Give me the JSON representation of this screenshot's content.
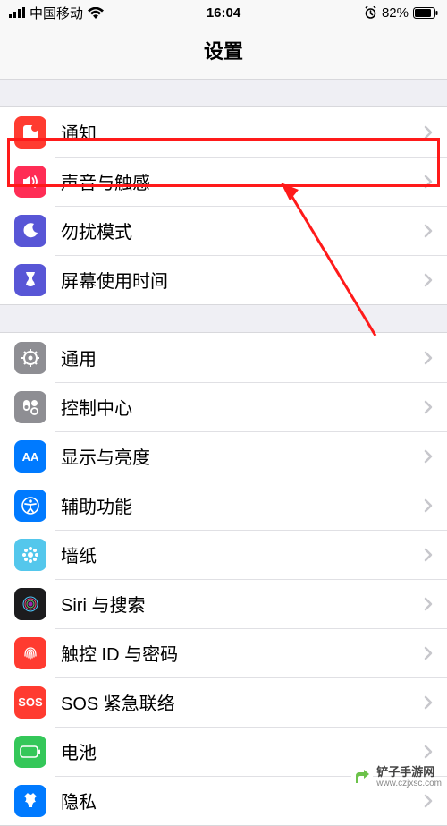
{
  "status": {
    "carrier": "中国移动",
    "time": "16:04",
    "battery_pct": "82%"
  },
  "title": "设置",
  "sections": [
    {
      "rows": [
        {
          "key": "notifications",
          "label": "通知",
          "icon": "notifications-icon",
          "color": "#ff3b30"
        },
        {
          "key": "sounds",
          "label": "声音与触感",
          "icon": "sounds-icon",
          "color": "#ff2d55"
        },
        {
          "key": "dnd",
          "label": "勿扰模式",
          "icon": "dnd-icon",
          "color": "#5856d6"
        },
        {
          "key": "screentime",
          "label": "屏幕使用时间",
          "icon": "screentime-icon",
          "color": "#5856d6"
        }
      ]
    },
    {
      "rows": [
        {
          "key": "general",
          "label": "通用",
          "icon": "general-icon",
          "color": "#8e8e93"
        },
        {
          "key": "controlcenter",
          "label": "控制中心",
          "icon": "controlcenter-icon",
          "color": "#8e8e93"
        },
        {
          "key": "display",
          "label": "显示与亮度",
          "icon": "display-icon",
          "color": "#007aff"
        },
        {
          "key": "accessibility",
          "label": "辅助功能",
          "icon": "accessibility-icon",
          "color": "#007aff"
        },
        {
          "key": "wallpaper",
          "label": "墙纸",
          "icon": "wallpaper-icon",
          "color": "#54c7ec"
        },
        {
          "key": "siri",
          "label": "Siri 与搜索",
          "icon": "siri-icon",
          "color": "#1c1c1e"
        },
        {
          "key": "touchid",
          "label": "触控 ID 与密码",
          "icon": "touchid-icon",
          "color": "#ff3b30"
        },
        {
          "key": "sos",
          "label": "SOS 紧急联络",
          "icon": "sos-icon",
          "color": "#ff3b30",
          "sos_text": "SOS"
        },
        {
          "key": "battery",
          "label": "电池",
          "icon": "battery-icon",
          "color": "#34c759"
        },
        {
          "key": "privacy",
          "label": "隐私",
          "icon": "privacy-icon",
          "color": "#007aff"
        }
      ]
    }
  ],
  "annotation": {
    "highlighted_row_key": "sounds"
  },
  "watermark": {
    "text": "铲子手游网",
    "url": "www.czjxsc.com"
  }
}
